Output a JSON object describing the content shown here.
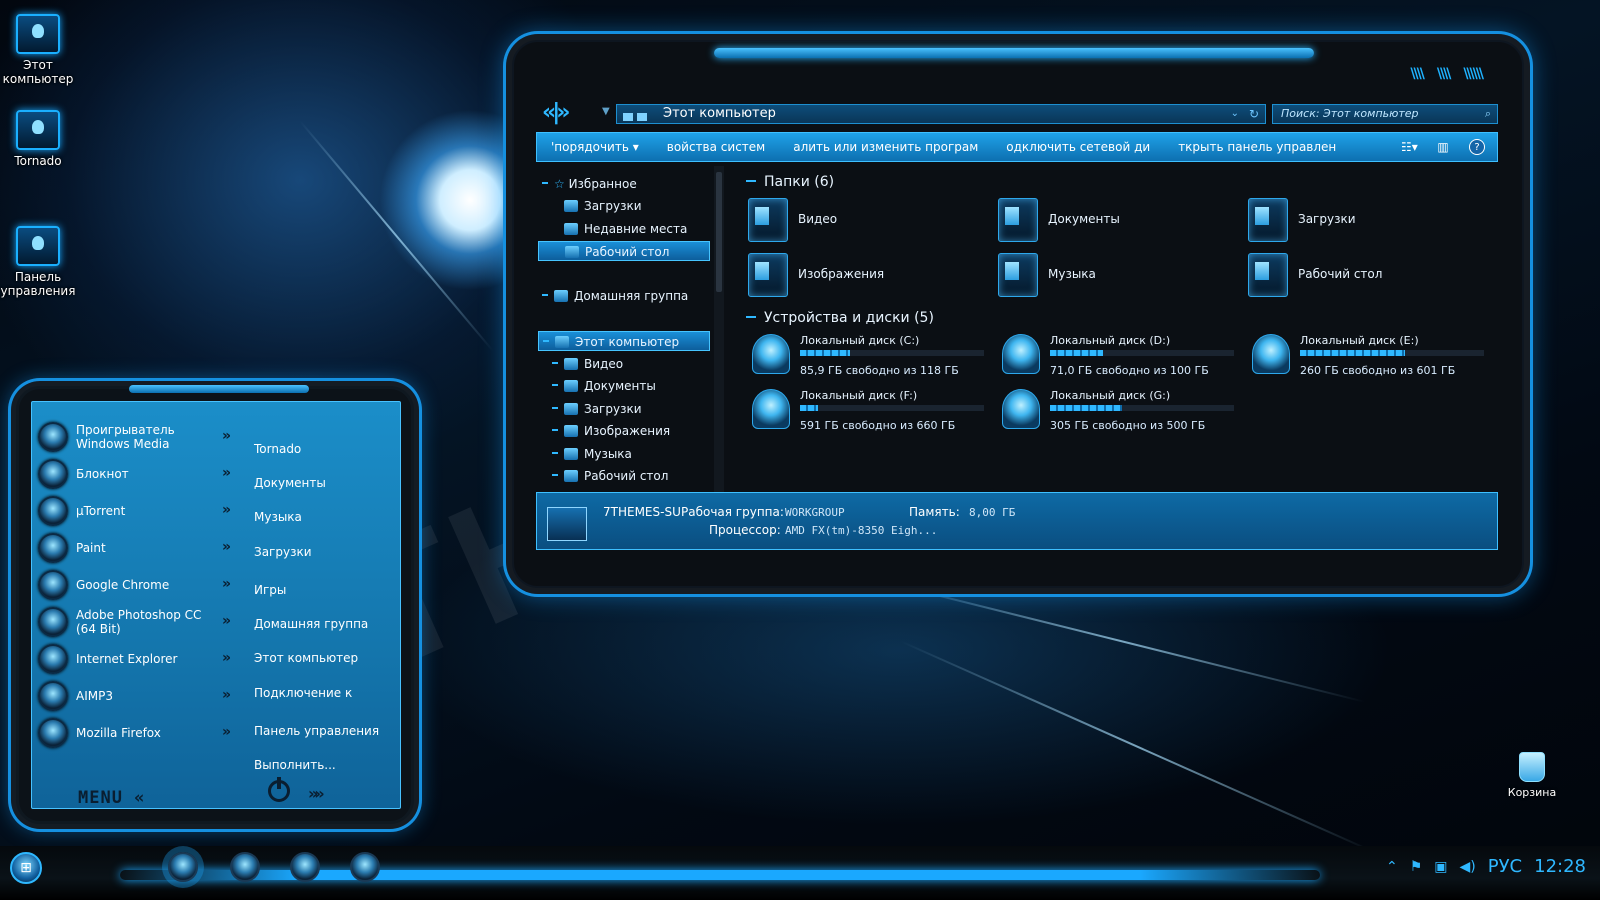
{
  "desktop": {
    "icons": [
      {
        "label": "Этот\nкомпьютер",
        "icon": "computer-icon"
      },
      {
        "label": "Tornado",
        "icon": "user-folder-icon"
      },
      {
        "label": "Панель\nуправления",
        "icon": "control-panel-icon"
      }
    ],
    "recycle_bin": "Корзина",
    "watermark": "7THEMES.SU"
  },
  "explorer": {
    "address": "Этот компьютер",
    "search_placeholder": "Поиск: Этот компьютер",
    "commands": [
      "'порядочить ▾",
      "войства систем",
      "алить или изменить програм",
      "одключить сетевой ди",
      "ткрыть панель управлен"
    ],
    "nav": {
      "favorites": "Избранное",
      "fav_items": [
        "Загрузки",
        "Недавние места",
        "Рабочий стол"
      ],
      "homegroup": "Домашняя группа",
      "this_pc": "Этот компьютер",
      "pc_items": [
        "Видео",
        "Документы",
        "Загрузки",
        "Изображения",
        "Музыка",
        "Рабочий стол"
      ]
    },
    "folders_header": "Папки (6)",
    "folders": [
      "Видео",
      "Документы",
      "Загрузки",
      "Изображения",
      "Музыка",
      "Рабочий стол"
    ],
    "drives_header": "Устройства и диски (5)",
    "drives": [
      {
        "name": "Локальный диск (C:)",
        "free": "85,9 ГБ свободно из 118 ГБ",
        "used_fraction": 0.27
      },
      {
        "name": "Локальный диск (D:)",
        "free": "71,0 ГБ свободно из 100 ГБ",
        "used_fraction": 0.29
      },
      {
        "name": "Локальный диск (E:)",
        "free": "260 ГБ свободно из 601 ГБ",
        "used_fraction": 0.57
      },
      {
        "name": "Локальный диск (F:)",
        "free": "591 ГБ свободно из 660 ГБ",
        "used_fraction": 0.1
      },
      {
        "name": "Локальный диск (G:)",
        "free": "305 ГБ свободно из 500 ГБ",
        "used_fraction": 0.39
      }
    ],
    "details": {
      "pc_name": "7THEMES-SU",
      "workgroup_label": "Рабочая группа:",
      "workgroup": "WORKGROUP",
      "memory_label": "Память:",
      "memory": "8,00 ГБ",
      "cpu_label": "Процессор:",
      "cpu": "AMD FX(tm)-8350 Eigh..."
    }
  },
  "start_menu": {
    "programs": [
      "Проигрыватель Windows Media",
      "Блокнот",
      "µTorrent",
      "Paint",
      "Google Chrome",
      "Adobe Photoshop CC (64 Bit)",
      "Internet Explorer",
      "AIMP3",
      "Mozilla Firefox"
    ],
    "places": [
      "Tornado",
      "Документы",
      "Музыка",
      "Загрузки",
      "Игры",
      "Домашняя группа",
      "Этот компьютер",
      "Подключение к",
      "Панель управления",
      "Выполнить..."
    ],
    "menu_label": "MENU «",
    "arrow": "»"
  },
  "taskbar": {
    "lang": "РУС",
    "clock": "12:28"
  },
  "colors": {
    "accent": "#1aa8ff",
    "panel": "#1476ad",
    "window_bg": "#0b0f14"
  }
}
